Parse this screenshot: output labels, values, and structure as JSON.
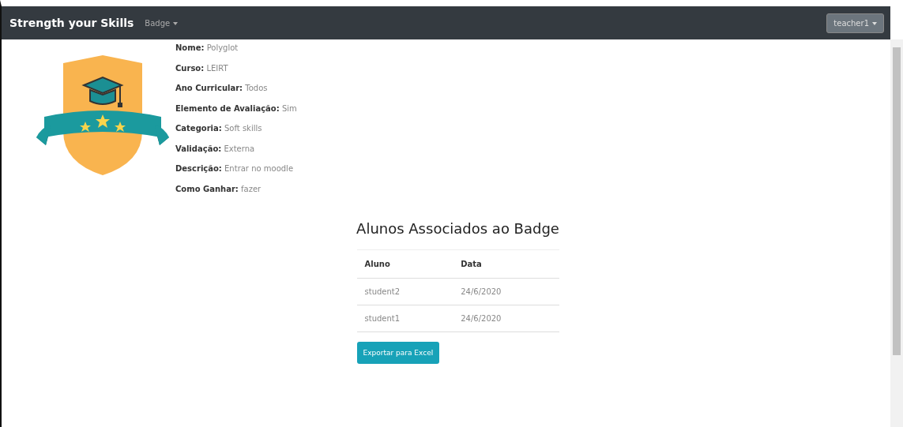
{
  "navbar": {
    "brand": "Strength your Skills",
    "menu": "Badge",
    "user": "teacher1"
  },
  "details": [
    {
      "label": "Nome:",
      "value": "Polyglot"
    },
    {
      "label": "Curso:",
      "value": "LEIRT"
    },
    {
      "label": "Ano Curricular:",
      "value": "Todos"
    },
    {
      "label": "Elemento de Avaliação:",
      "value": "Sim"
    },
    {
      "label": "Categoria:",
      "value": "Soft skills"
    },
    {
      "label": "Validação:",
      "value": "Externa"
    },
    {
      "label": "Descrição:",
      "value": "Entrar no moodle"
    },
    {
      "label": "Como Ganhar:",
      "value": "fazer"
    }
  ],
  "students_section": {
    "title": "Alunos Associados ao Badge",
    "table": {
      "columns": [
        "Aluno",
        "Data"
      ],
      "rows": [
        [
          "student2",
          "24/6/2020"
        ],
        [
          "student1",
          "24/6/2020"
        ]
      ]
    },
    "export_button": "Exportar para Excel"
  }
}
